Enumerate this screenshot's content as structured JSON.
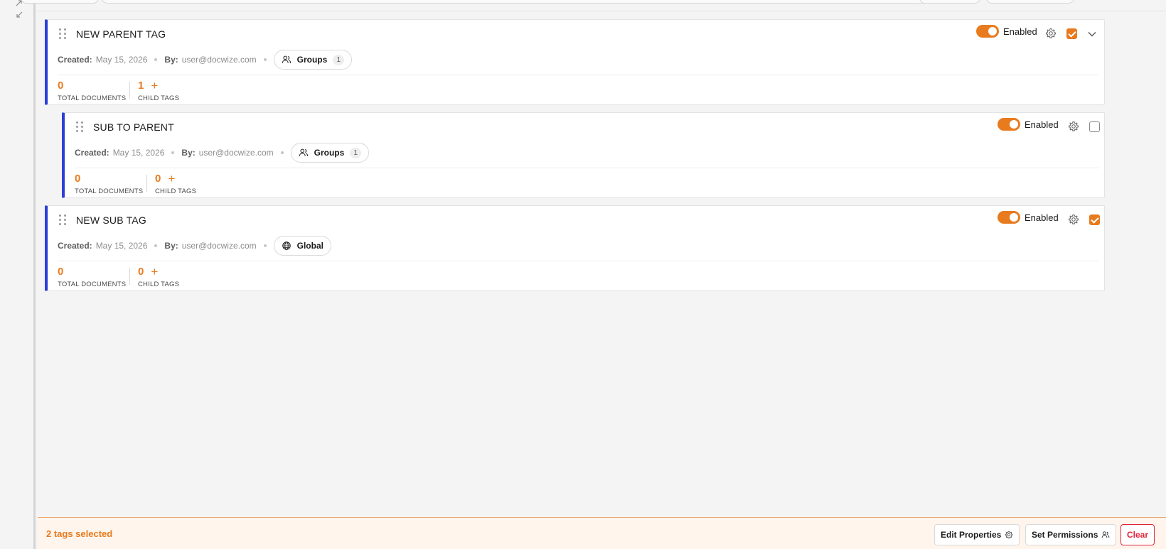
{
  "tags": [
    {
      "name": "NEW PARENT TAG",
      "created_label": "Created:",
      "created_date": "May 15, 2026",
      "by_label": "By:",
      "by_user": "user@docwize.com",
      "scope_label": "Groups",
      "scope_count": "1",
      "scope_icon": "users-icon",
      "total_documents": "0",
      "total_documents_label": "TOTAL DOCUMENTS",
      "child_tags": "1",
      "child_tags_label": "CHILD TAGS",
      "status_label": "Enabled",
      "enabled": true,
      "selected": true,
      "expandable": true
    },
    {
      "name": "SUB TO PARENT",
      "created_label": "Created:",
      "created_date": "May 15, 2026",
      "by_label": "By:",
      "by_user": "user@docwize.com",
      "scope_label": "Groups",
      "scope_count": "1",
      "scope_icon": "users-icon",
      "total_documents": "0",
      "total_documents_label": "TOTAL DOCUMENTS",
      "child_tags": "0",
      "child_tags_label": "CHILD TAGS",
      "status_label": "Enabled",
      "enabled": true,
      "selected": false,
      "expandable": false
    },
    {
      "name": "NEW SUB TAG",
      "created_label": "Created:",
      "created_date": "May 15, 2026",
      "by_label": "By:",
      "by_user": "user@docwize.com",
      "scope_label": "Global",
      "scope_icon": "globe-icon",
      "total_documents": "0",
      "total_documents_label": "TOTAL DOCUMENTS",
      "child_tags": "0",
      "child_tags_label": "CHILD TAGS",
      "status_label": "Enabled",
      "enabled": true,
      "selected": true,
      "expandable": false
    }
  ],
  "selection_bar": {
    "selected_text": "2 tags selected",
    "edit_properties_label": "Edit Properties",
    "set_permissions_label": "Set Permissions",
    "clear_label": "Clear"
  },
  "colors": {
    "accent": "#e87b1e",
    "card_border_left": "#2b3fd6",
    "danger": "#e0243a",
    "selection_bar_bg": "#fff5ec"
  }
}
